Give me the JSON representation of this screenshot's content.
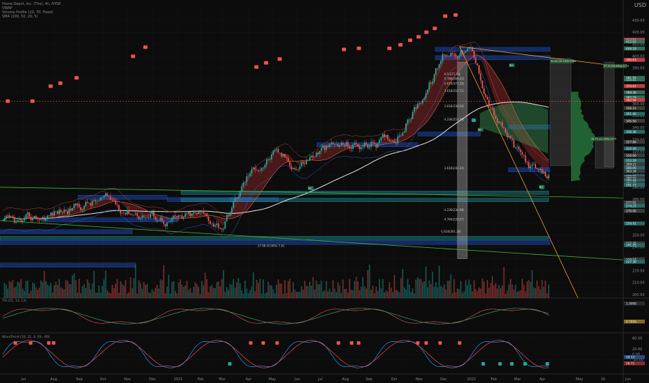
{
  "header": {
    "instrument": "Home Depot, Inc. (The), 4h, NYSE",
    "indicators": [
      "VWAP",
      "Volume Profile (20, 70, Fixed)",
      "SMA (200, 50, 20, 5)"
    ],
    "currency": "USD"
  },
  "colors": {
    "background": "#0c0c0c",
    "bull": "#26a69a",
    "bear": "#ef5350",
    "trend_green": "#3fb93a",
    "trend_orange": "#f0a030",
    "sma200": "#e8e8e8"
  },
  "chart_data": [
    {
      "type": "candlestick",
      "price_axis_ticks": [
        "430.00",
        "420.00",
        "410.00",
        "400.00",
        "390.00",
        "380.00",
        "370.00",
        "360.00",
        "350.00",
        "340.00",
        "330.00",
        "320.00",
        "310.00",
        "300.00",
        "290.00",
        "280.00",
        "270.00",
        "260.00",
        "250.00",
        "240.00",
        "230.00",
        "220.00",
        "210.00",
        "200.00"
      ],
      "ylim": [
        197,
        440
      ],
      "time_axis_labels": [
        "Jul",
        "Aug",
        "Sep",
        "Oct",
        "Nov",
        "Dec",
        "2021",
        "Feb",
        "Mar",
        "Apr",
        "May",
        "Jun",
        "Jul",
        "Aug",
        "Sep",
        "Oct",
        "Nov",
        "Dec",
        "2022",
        "Feb",
        "Mar",
        "Apr",
        "May",
        "16",
        "Jun"
      ],
      "axis_price_badges": [
        "413.51",
        "412.01",
        "406.18",
        "396.63",
        "380.20",
        "381.55",
        "374.67",
        "369.39",
        "365.29",
        "362.94",
        "356.21",
        "351.40",
        "345.50",
        "336.36",
        "327.86",
        "322.29",
        "316.60",
        "312.29",
        "309.21",
        "306.05",
        "303.34",
        "298.90",
        "297.52",
        "295.44",
        "293.23",
        "291.71",
        "277.01",
        "274.21",
        "270.00",
        "259.41",
        "242.79",
        "241.25",
        "229.19",
        "227.30"
      ],
      "trend_approx_close": [
        [
          "Jul",
          258
        ],
        [
          "Aug",
          268
        ],
        [
          "Sep",
          275
        ],
        [
          "Oct",
          279
        ],
        [
          "Nov",
          272
        ],
        [
          "Dec",
          266
        ],
        [
          "2021",
          262
        ],
        [
          "Feb",
          266
        ],
        [
          "Mar",
          258
        ],
        [
          "Apr",
          300
        ],
        [
          "May",
          318
        ],
        [
          "Jun",
          308
        ],
        [
          "Jul",
          321
        ],
        [
          "Aug",
          324
        ],
        [
          "Sep",
          326
        ],
        [
          "Oct",
          331
        ],
        [
          "Nov",
          362
        ],
        [
          "Dec",
          398
        ],
        [
          "2022",
          402
        ],
        [
          "Feb",
          352
        ],
        [
          "Mar",
          318
        ],
        [
          "Apr",
          297
        ]
      ],
      "fib_levels": [
        "0.5(377.74)",
        "0.786(366.42)",
        "0.618(375.38)",
        "1.618(352.71)",
        "2.618(338.00)",
        "4.236(253.38)",
        "3.618(242.34)",
        "4.236(234.98)",
        "4.764(228.67)",
        "-1.618(261.28)",
        "27.08 (9.56%) 7.61"
      ],
      "measure_labels": [
        "93.46 (30.16%) 5580",
        "97.15 (25.48%) 9770",
        "32.75 (11.16%) 2270"
      ],
      "annotations": [
        "B1",
        "B2",
        "B3",
        "B4"
      ],
      "markers": {
        "sell": [
          [
            0.012,
            0.265
          ],
          [
            0.05,
            0.265
          ],
          [
            0.078,
            0.226
          ],
          [
            0.093,
            0.218
          ],
          [
            0.118,
            0.204
          ],
          [
            0.205,
            0.148
          ],
          [
            0.224,
            0.124
          ],
          [
            0.395,
            0.176
          ],
          [
            0.41,
            0.165
          ],
          [
            0.431,
            0.155
          ],
          [
            0.53,
            0.13
          ],
          [
            0.553,
            0.127
          ],
          [
            0.6,
            0.127
          ],
          [
            0.617,
            0.118
          ],
          [
            0.632,
            0.106
          ],
          [
            0.645,
            0.097
          ],
          [
            0.657,
            0.085
          ],
          [
            0.67,
            0.075
          ],
          [
            0.686,
            0.043
          ],
          [
            0.702,
            0.04
          ]
        ],
        "buy": [
          [
            0.48,
            0.493
          ],
          [
            0.73,
            0.315
          ],
          [
            0.835,
            0.49
          ]
        ]
      }
    },
    {
      "type": "line",
      "title": "TSI (25, 13, 13)",
      "price_axis_ticks": [
        "1.0000",
        "0.7856"
      ]
    },
    {
      "type": "line",
      "title": "WaveTrend (10, 21, 4, 60, -60)",
      "price_axis_ticks": [
        "60.00",
        "20.00",
        "0.00",
        "-20.00"
      ],
      "axis_price_badges": [
        "28.53",
        "26.71"
      ]
    }
  ]
}
